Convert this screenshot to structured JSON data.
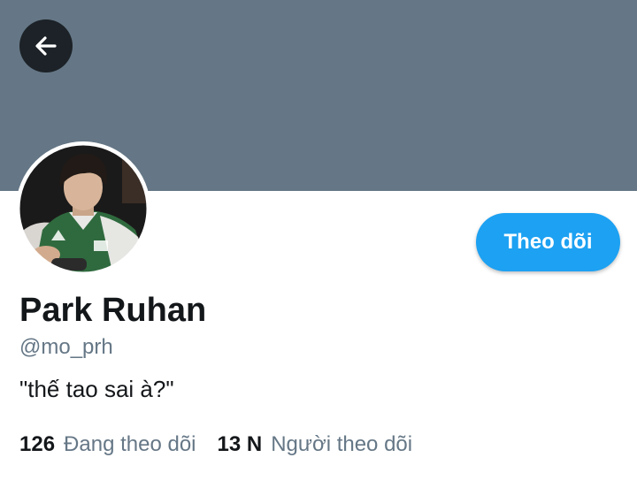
{
  "header": {
    "back_icon": "arrow-left-icon",
    "banner_color": "#657786"
  },
  "profile": {
    "display_name": "Park Ruhan",
    "username": "@mo_prh",
    "bio": "\"thế tao sai à?\"",
    "avatar_description": "profile-photo"
  },
  "actions": {
    "follow_label": "Theo dõi",
    "follow_color": "#1da1f2"
  },
  "stats": {
    "following_count": "126",
    "following_label": "Đang theo dõi",
    "followers_count": "13 N",
    "followers_label": "Người theo dõi"
  }
}
